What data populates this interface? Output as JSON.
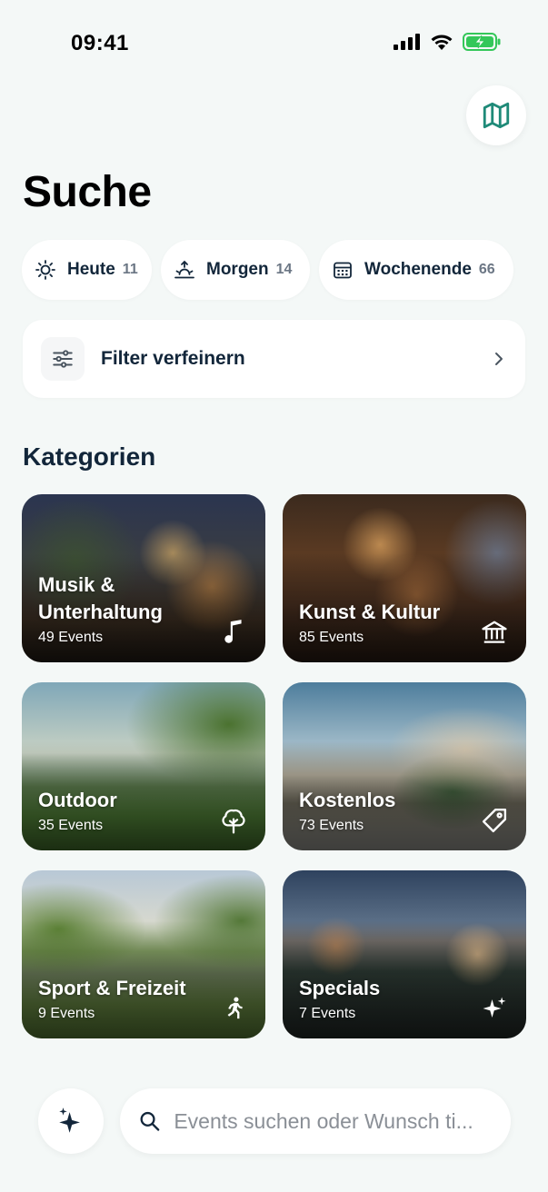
{
  "status_bar": {
    "time": "09:41"
  },
  "header": {
    "title": "Suche",
    "map_icon": "map-icon"
  },
  "chips": [
    {
      "label": "Heute",
      "count": "11",
      "icon": "sun-icon"
    },
    {
      "label": "Morgen",
      "count": "14",
      "icon": "sunrise-icon"
    },
    {
      "label": "Wochenende",
      "count": "66",
      "icon": "calendar-icon"
    }
  ],
  "filter": {
    "label": "Filter verfeinern",
    "icon": "sliders-icon"
  },
  "categories_section": {
    "title": "Kategorien"
  },
  "categories": [
    {
      "title": "Musik & Unterhaltung",
      "count": "49 Events",
      "icon": "music-note-icon"
    },
    {
      "title": "Kunst & Kultur",
      "count": "85 Events",
      "icon": "museum-icon"
    },
    {
      "title": "Outdoor",
      "count": "35 Events",
      "icon": "tree-icon"
    },
    {
      "title": "Kostenlos",
      "count": "73 Events",
      "icon": "tag-icon"
    },
    {
      "title": "Sport & Freizeit",
      "count": "9 Events",
      "icon": "running-icon"
    },
    {
      "title": "Specials",
      "count": "7 Events",
      "icon": "sparkles-icon"
    }
  ],
  "bottom": {
    "ai_icon": "sparkles-icon",
    "search_placeholder": "Events suchen oder Wunsch ti..."
  },
  "colors": {
    "accent": "#1f8a78",
    "heading": "#12263a",
    "background": "#f4f8f7"
  }
}
